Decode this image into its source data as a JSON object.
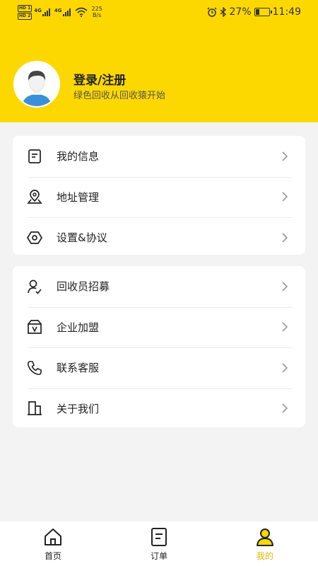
{
  "status_bar": {
    "sim1": "HD 1",
    "sim2": "HD 2",
    "net1": "4G",
    "net2": "4G",
    "speed_value": "225",
    "speed_unit": "B/s",
    "battery_percent": "27%",
    "battery_level": 0.27,
    "time": "11:49"
  },
  "profile": {
    "title": "登录/注册",
    "subtitle": "绿色回收从回收猿开始"
  },
  "menu_group_1": [
    {
      "label": "我的信息",
      "icon": "document-icon"
    },
    {
      "label": "地址管理",
      "icon": "map-pin-icon"
    },
    {
      "label": "设置&协议",
      "icon": "hexagon-settings-icon"
    }
  ],
  "menu_group_2": [
    {
      "label": "回收员招募",
      "icon": "user-check-icon"
    },
    {
      "label": "企业加盟",
      "icon": "v-box-icon"
    },
    {
      "label": "联系客服",
      "icon": "phone-icon"
    },
    {
      "label": "关于我们",
      "icon": "building-icon"
    }
  ],
  "tabbar": {
    "home": "首页",
    "orders": "订单",
    "mine": "我的",
    "active_color": "#e6b800"
  },
  "colors": {
    "header": "#fcd800",
    "background": "#f3f3f3"
  }
}
